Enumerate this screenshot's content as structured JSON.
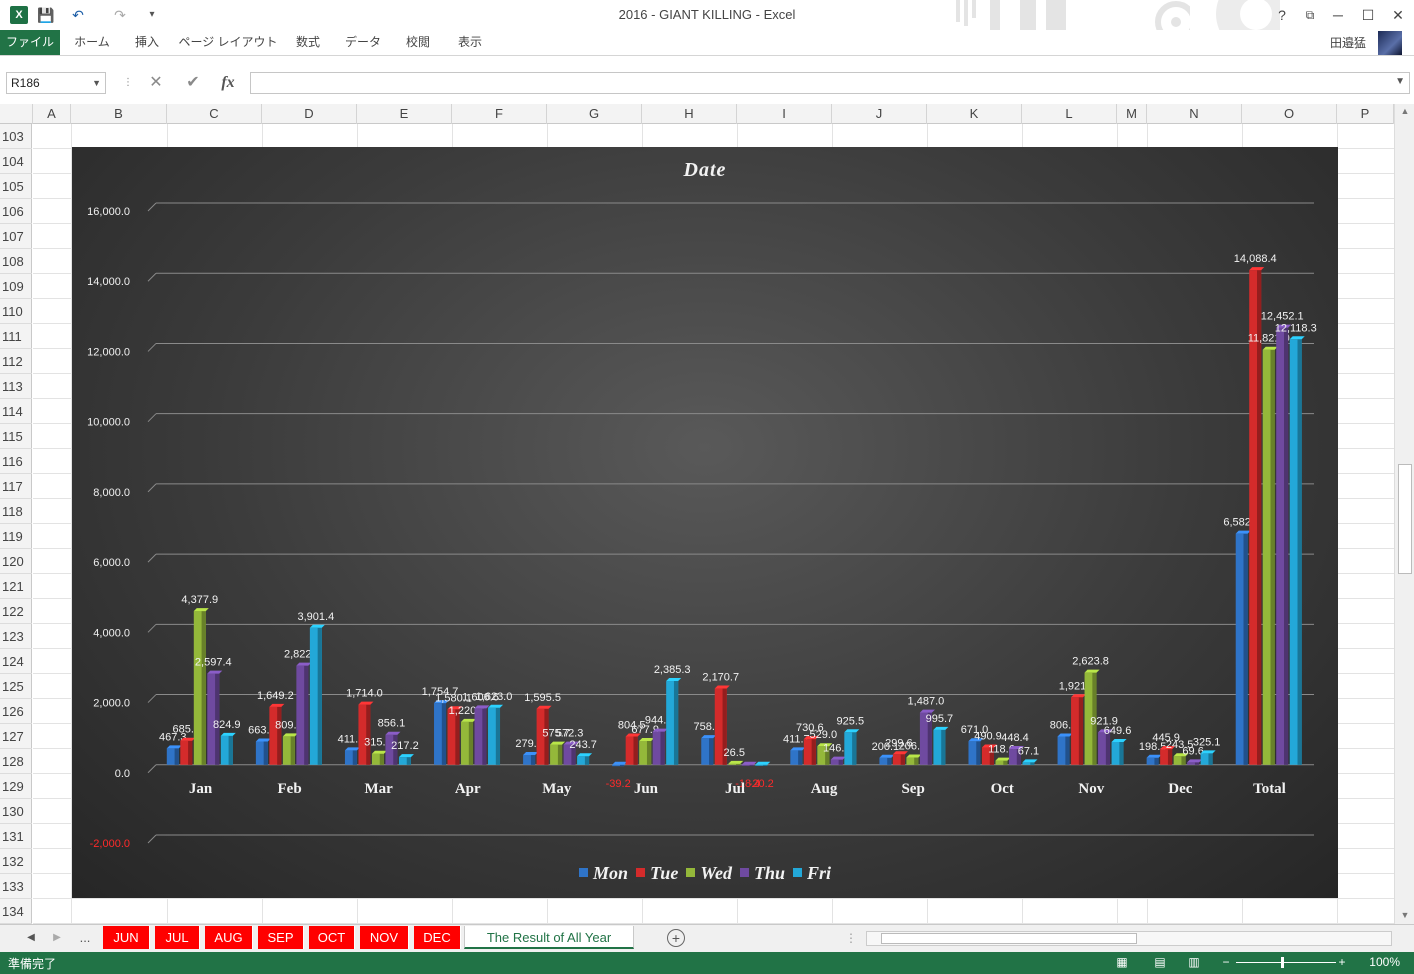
{
  "window": {
    "title": "2016 - GIANT KILLING - Excel",
    "app_icon": "X",
    "help": "?",
    "restore_ribbon": "⧉",
    "minimize": "─",
    "maximize": "☐",
    "close": "✕"
  },
  "quick_access": {
    "save_icon": "💾",
    "undo_icon": "↶",
    "redo_icon": "↷",
    "customize_icon": "▾"
  },
  "ribbon": {
    "tabs": [
      "ファイル",
      "ホーム",
      "挿入",
      "ページ レイアウト",
      "数式",
      "データ",
      "校閲",
      "表示"
    ],
    "user_name": "田邉猛"
  },
  "formula_bar": {
    "name_box": "R186",
    "cancel_icon": "✕",
    "enter_icon": "✔",
    "fx_label": "fx",
    "formula": ""
  },
  "columns": [
    "A",
    "B",
    "C",
    "D",
    "E",
    "F",
    "G",
    "H",
    "I",
    "J",
    "K",
    "L",
    "M",
    "N",
    "O",
    "P"
  ],
  "rows": [
    "103",
    "104",
    "105",
    "106",
    "107",
    "108",
    "109",
    "110",
    "111",
    "112",
    "113",
    "114",
    "115",
    "116",
    "117",
    "118",
    "119",
    "120",
    "121",
    "122",
    "123",
    "124",
    "125",
    "126",
    "127",
    "128",
    "129",
    "130",
    "131",
    "132",
    "133",
    "134"
  ],
  "chart_data": {
    "type": "bar",
    "title": "Date",
    "categories": [
      "Jan",
      "Feb",
      "Mar",
      "Apr",
      "May",
      "Jun",
      "Jul",
      "Aug",
      "Sep",
      "Oct",
      "Nov",
      "Dec",
      "Total"
    ],
    "ylim": [
      -2000,
      16000
    ],
    "yticks": [
      "16,000.0",
      "14,000.0",
      "12,000.0",
      "10,000.0",
      "8,000.0",
      "6,000.0",
      "4,000.0",
      "2,000.0",
      "0.0",
      "-2,000.0"
    ],
    "grid": true,
    "legend_position": "bottom",
    "colors": {
      "Mon": "#2f74c8",
      "Tue": "#d42b2b",
      "Wed": "#94b83a",
      "Thu": "#6f4aa0",
      "Fri": "#23a8d8",
      "negative_label": "#ff2a2a"
    },
    "series": [
      {
        "name": "Mon",
        "values": [
          467.3,
          663.2,
          411.5,
          1754.7,
          279.0,
          -39.2,
          758.6,
          411.7,
          200.1,
          671.0,
          806.7,
          198.5,
          6582.6
        ],
        "labels": [
          "467.3",
          "663.2",
          "411.5",
          "1,754.7",
          "279.0",
          "-39.2",
          "758.6",
          "411.7",
          "200.1",
          "671.0",
          "806.7",
          "198.5",
          "6,582.6"
        ]
      },
      {
        "name": "Tue",
        "values": [
          685.3,
          1649.2,
          1714.0,
          1580.1,
          1595.5,
          804.5,
          2170.7,
          730.6,
          299.6,
          490.9,
          1921.6,
          445.9,
          14088.4
        ],
        "labels": [
          "685.3",
          "1,649.2",
          "1,714.0",
          "1,580.1",
          "1,595.5",
          "804.5",
          "2,170.7",
          "730.6",
          "299.6",
          "490.9",
          "1,921.6",
          "445.9",
          "14,088.4"
        ]
      },
      {
        "name": "Wed",
        "values": [
          4377.9,
          809.4,
          315.1,
          1220.4,
          575.7,
          677.9,
          26.5,
          529.0,
          206.2,
          118.6,
          2623.8,
          243.5,
          11821.0
        ],
        "labels": [
          "4,377.9",
          "809.4",
          "315.1",
          "1,220.4",
          "575.7",
          "677.9",
          "26.5",
          "529.0",
          "206.2",
          "118.6",
          "2,623.8",
          "243.5",
          "11,821.0"
        ]
      },
      {
        "name": "Thu",
        "values": [
          2597.4,
          2822.6,
          856.1,
          1606.6,
          572.3,
          944.9,
          -18.4,
          146.5,
          1487.0,
          448.4,
          921.9,
          69.6,
          12452.1
        ],
        "labels": [
          "2,597.4",
          "2,822.6",
          "856.1",
          "1,606.6",
          "572.3",
          "944.9",
          "-18.4",
          "146.5",
          "1,487.0",
          "448.4",
          "921.9",
          "69.6",
          "12,452.1"
        ]
      },
      {
        "name": "Fri",
        "values": [
          824.9,
          3901.4,
          217.2,
          1623.0,
          243.7,
          2385.3,
          -20.2,
          925.5,
          995.7,
          67.1,
          649.6,
          325.1,
          12118.3
        ],
        "labels": [
          "824.9",
          "3,901.4",
          "217.2",
          "1,623.0",
          "243.7",
          "2,385.3",
          "-20.2",
          "925.5",
          "995.7",
          "67.1",
          "649.6",
          "325.1",
          "12,118.3"
        ]
      }
    ]
  },
  "sheet_tabs": {
    "ellipsis": "...",
    "tabs": [
      "JUN",
      "JUL",
      "AUG",
      "SEP",
      "OCT",
      "NOV",
      "DEC",
      "The Result of All Year"
    ],
    "active": "The Result of All Year"
  },
  "status": {
    "ready": "準備完了",
    "zoom": "100%"
  }
}
